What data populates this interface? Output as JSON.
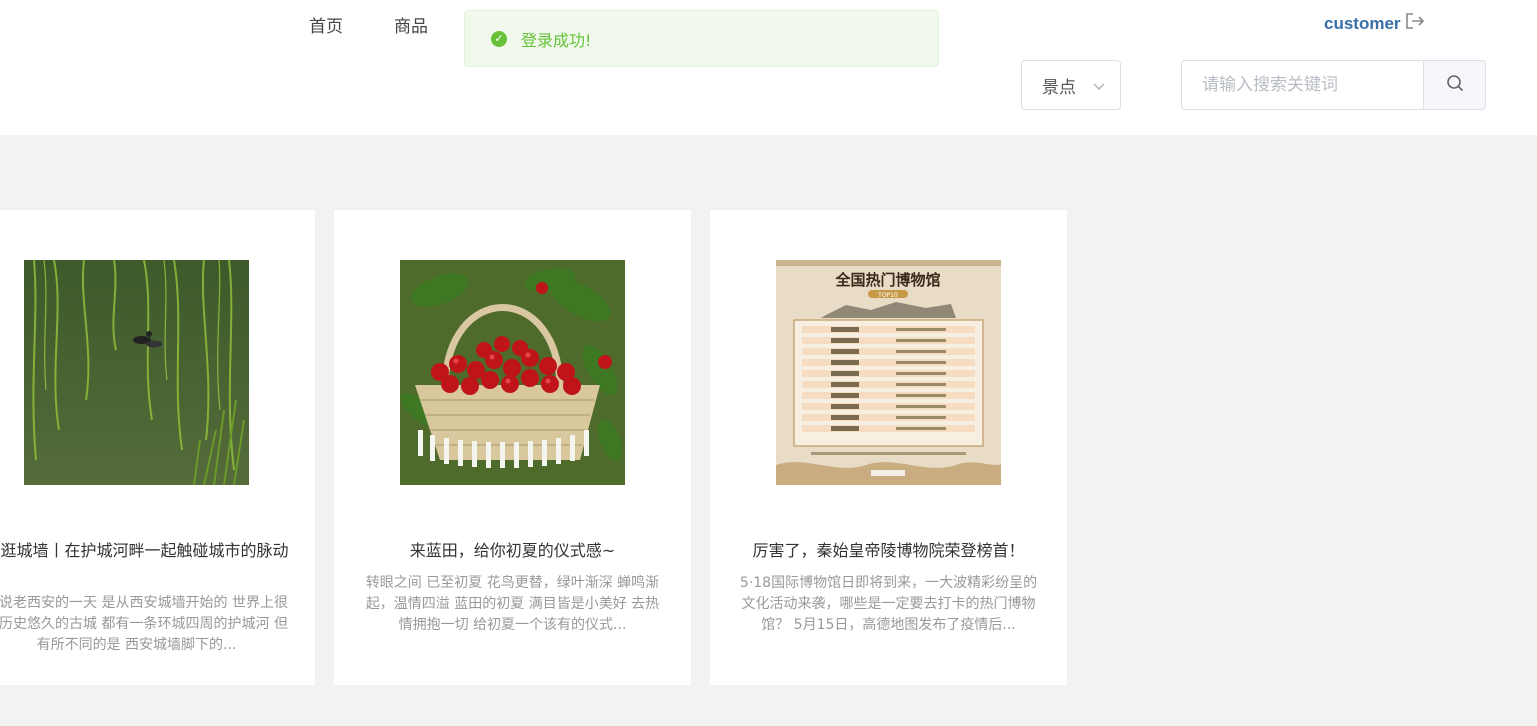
{
  "nav": {
    "home": "首页",
    "goods": "商品"
  },
  "toast": {
    "message": "登录成功!",
    "color": "#67c23a"
  },
  "user": {
    "name": "customer",
    "icon": "logout-icon"
  },
  "filter": {
    "selected": "景点"
  },
  "search": {
    "placeholder": "请输入搜索关键词",
    "value": "",
    "icon": "search-icon"
  },
  "cards": [
    {
      "title": "东逛城墙丨在护城河畔一起触碰城市的脉动",
      "desc": "人说老西安的一天  是从西安城墙开始的  世界上很多历史悠久的古城  都有一条环城四周的护城河  但有所不同的是  西安城墙脚下的..."
    },
    {
      "title": "来蓝田，给你初夏的仪式感~",
      "desc": "转眼之间  已至初夏  花鸟更替，绿叶渐深  蝉鸣渐起，温情四溢  蓝田的初夏  满目皆是小美好  去热情拥抱一切  给初夏一个该有的仪式..."
    },
    {
      "title": "厉害了，秦始皇帝陵博物院荣登榜首！",
      "desc": "5·18国际博物馆日即将到来，一大波精彩纷呈的文化活动来袭，哪些是一定要去打卡的热门博物馆？  5月15日，高德地图发布了疫情后..."
    }
  ],
  "poster": {
    "title": "全国热门博物馆",
    "subtitle": "TOP10"
  }
}
